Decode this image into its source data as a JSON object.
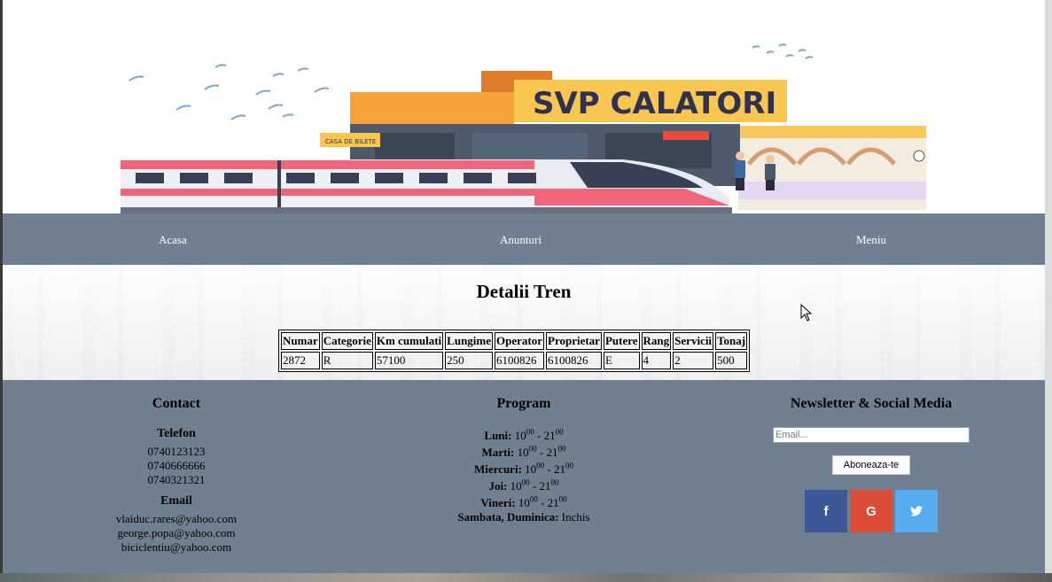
{
  "banner": {
    "station_sign": "SVP CALATORI",
    "ticket_sign": "CASA DE BILETE"
  },
  "nav": {
    "items": [
      "Acasa",
      "Anunturi",
      "Meniu"
    ]
  },
  "main": {
    "title": "Detalii Tren",
    "table": {
      "headers": [
        "Numar",
        "Categorie",
        "Km cumulati",
        "Lungime",
        "Operator",
        "Proprietar",
        "Putere",
        "Rang",
        "Servicii",
        "Tonaj"
      ],
      "rows": [
        [
          "2872",
          "R",
          "57100",
          "250",
          "6100826",
          "6100826",
          "E",
          "4",
          "2",
          "500"
        ]
      ]
    }
  },
  "footer": {
    "contact": {
      "title": "Contact",
      "phone_label": "Telefon",
      "phones": [
        "0740123123",
        "0740666666",
        "0740321321"
      ],
      "email_label": "Email",
      "emails": [
        "vlaiduc.rares@yahoo.com",
        "george.popa@yahoo.com",
        "biciclentiu@yahoo.com"
      ]
    },
    "program": {
      "title": "Program",
      "days": [
        {
          "day": "Luni:",
          "open": "10",
          "close": "21",
          "sup": "00"
        },
        {
          "day": "Marti:",
          "open": "10",
          "close": "21",
          "sup": "00"
        },
        {
          "day": "Miercuri:",
          "open": "10",
          "close": "21",
          "sup": "00"
        },
        {
          "day": "Joi:",
          "open": "10",
          "close": "21",
          "sup": "00"
        },
        {
          "day": "Vineri:",
          "open": "10",
          "close": "21",
          "sup": "00"
        }
      ],
      "weekend_label": "Sambata, Duminica:",
      "weekend_value": "Inchis"
    },
    "newsletter": {
      "title": "Newsletter & Social Media",
      "email_placeholder": "Email...",
      "subscribe_label": "Aboneaza-te",
      "social": [
        {
          "name": "facebook",
          "glyph": "f",
          "color": "#3b5998"
        },
        {
          "name": "google",
          "glyph": "G",
          "color": "#dd4b39"
        },
        {
          "name": "twitter",
          "glyph": "🐦",
          "color": "#55acee"
        }
      ]
    }
  },
  "colors": {
    "nav_bg": "#708090",
    "footer_bg": "#708090"
  }
}
